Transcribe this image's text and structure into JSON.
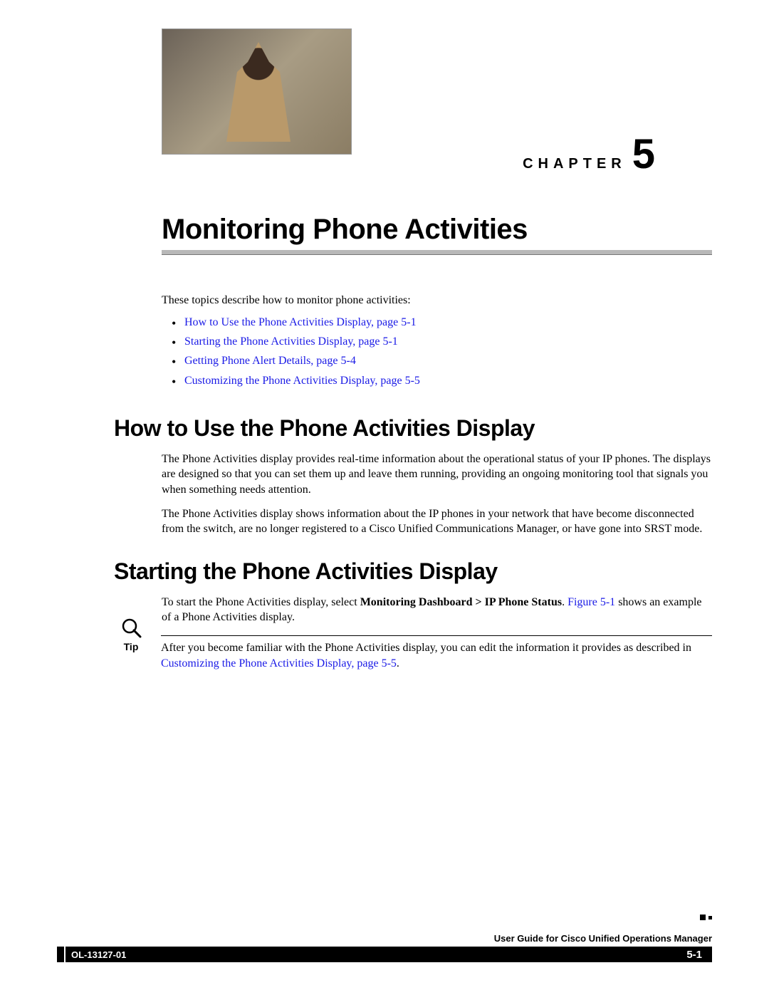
{
  "chapter": {
    "label": "CHAPTER",
    "number": "5"
  },
  "title": "Monitoring Phone Activities",
  "intro": "These topics describe how to monitor phone activities:",
  "toc": [
    "How to Use the Phone Activities Display, page 5-1",
    "Starting the Phone Activities Display, page 5-1",
    "Getting Phone Alert Details, page 5-4",
    "Customizing the Phone Activities Display, page 5-5"
  ],
  "section1": {
    "heading": "How to Use the Phone Activities Display",
    "para1": "The Phone Activities display provides real-time information about the operational status of your IP phones. The displays are designed so that you can set them up and leave them running, providing an ongoing monitoring tool that signals you when something needs attention.",
    "para2": "The Phone Activities display shows information about the IP phones in your network that have become disconnected from the switch, are no longer registered to a Cisco Unified Communications Manager, or have gone into SRST mode."
  },
  "section2": {
    "heading": "Starting the Phone Activities Display",
    "para1_pre": "To start the Phone Activities display, select ",
    "para1_bold": "Monitoring Dashboard > IP Phone Status",
    "para1_mid": ". ",
    "para1_link": "Figure 5-1",
    "para1_post": " shows an example of a Phone Activities display.",
    "tip_label": "Tip",
    "tip_text_pre": "After you become familiar with the Phone Activities display, you can edit the information it provides as described in ",
    "tip_link": "Customizing the Phone Activities Display, page 5-5",
    "tip_text_post": "."
  },
  "footer": {
    "guide": "User Guide for Cisco Unified Operations Manager",
    "docnum": "OL-13127-01",
    "pagenum": "5-1"
  }
}
